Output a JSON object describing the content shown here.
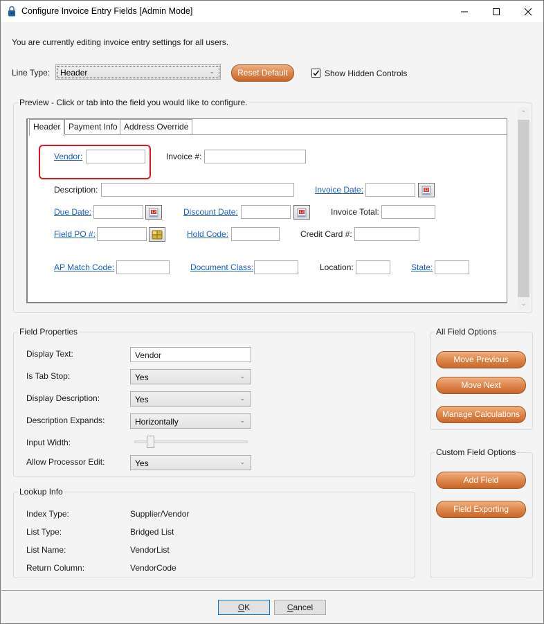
{
  "window": {
    "title": "Configure Invoice Entry Fields [Admin Mode]",
    "icon": "lock-icon",
    "controls": {
      "minimize": "minimize-icon",
      "maximize": "maximize-icon",
      "close": "close-icon"
    }
  },
  "intro_text": "You are currently editing invoice entry settings for all users.",
  "line_type": {
    "label": "Line Type:",
    "value": "Header"
  },
  "reset_default_label": "Reset Default",
  "show_hidden_controls": {
    "label": "Show Hidden Controls",
    "checked": true
  },
  "preview": {
    "legend": "Preview - Click or tab into the field you would like to configure.",
    "tabs": [
      {
        "label": "Header",
        "active": true
      },
      {
        "label": "Payment Info",
        "active": false
      },
      {
        "label": "Address Override",
        "active": false
      }
    ],
    "fields": {
      "vendor": {
        "label": "Vendor:",
        "link": true,
        "selected": true,
        "value": ""
      },
      "invoice_no": {
        "label": "Invoice #:",
        "link": false,
        "value": ""
      },
      "description": {
        "label": "Description:",
        "link": false,
        "value": ""
      },
      "invoice_date": {
        "label": "Invoice Date:",
        "link": true,
        "value": "",
        "button_icon": "calendar-icon"
      },
      "due_date": {
        "label": "Due Date:",
        "link": true,
        "value": "",
        "button_icon": "calendar-icon"
      },
      "discount_date": {
        "label": "Discount Date:",
        "link": true,
        "value": "",
        "button_icon": "calendar-icon"
      },
      "invoice_total": {
        "label": "Invoice Total:",
        "link": false,
        "value": ""
      },
      "field_po": {
        "label": "Field PO #:",
        "link": true,
        "value": "",
        "button_icon": "blocks-icon"
      },
      "hold_code": {
        "label": "Hold Code:",
        "link": true,
        "value": ""
      },
      "credit_card": {
        "label": "Credit Card #:",
        "link": false,
        "value": ""
      },
      "ap_match_code": {
        "label": "AP Match Code:",
        "link": true,
        "value": ""
      },
      "document_class": {
        "label": "Document Class:",
        "link": true,
        "value": ""
      },
      "location": {
        "label": "Location:",
        "link": false,
        "value": ""
      },
      "state": {
        "label": "State:",
        "link": true,
        "value": ""
      }
    }
  },
  "field_properties": {
    "legend": "Field Properties",
    "display_text": {
      "label": "Display Text:",
      "value": "Vendor"
    },
    "is_tab_stop": {
      "label": "Is Tab Stop:",
      "value": "Yes"
    },
    "display_description": {
      "label": "Display Description:",
      "value": "Yes"
    },
    "description_expands": {
      "label": "Description Expands:",
      "value": "Horizontally"
    },
    "input_width": {
      "label": "Input Width:",
      "value_fraction": 0.12
    },
    "allow_processor_edit": {
      "label": "Allow Processor Edit:",
      "value": "Yes"
    }
  },
  "lookup_info": {
    "legend": "Lookup Info",
    "rows": [
      {
        "label": "Index Type:",
        "value": "Supplier/Vendor"
      },
      {
        "label": "List Type:",
        "value": "Bridged List"
      },
      {
        "label": "List Name:",
        "value": "VendorList"
      },
      {
        "label": "Return Column:",
        "value": "VendorCode"
      }
    ]
  },
  "all_field_options": {
    "legend": "All Field Options",
    "buttons": [
      "Move Previous",
      "Move Next",
      "Manage Calculations"
    ]
  },
  "custom_field_options": {
    "legend": "Custom Field Options",
    "buttons": [
      "Add Field",
      "Field Exporting"
    ]
  },
  "footer": {
    "ok": {
      "mnemonic": "O",
      "rest": "K"
    },
    "cancel": {
      "mnemonic": "C",
      "rest": "ancel"
    }
  },
  "colors": {
    "accent_orange": "#d97a3f",
    "link_blue": "#1a5fc4",
    "highlight_red": "#e0141e",
    "default_button_border": "#0078d7"
  }
}
